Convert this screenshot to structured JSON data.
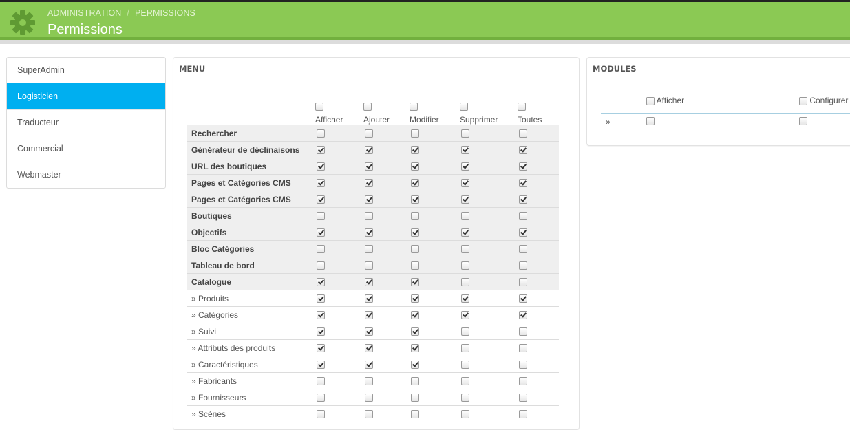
{
  "header": {
    "breadcrumb": [
      "ADMINISTRATION",
      "PERMISSIONS"
    ],
    "title": "Permissions",
    "colors": {
      "bar": "#8bc954",
      "accent_blue": "#00aff0"
    },
    "icon": "gear-icon"
  },
  "sidebar": {
    "items": [
      {
        "label": "SuperAdmin",
        "active": false
      },
      {
        "label": "Logisticien",
        "active": true
      },
      {
        "label": "Traducteur",
        "active": false
      },
      {
        "label": "Commercial",
        "active": false
      },
      {
        "label": "Webmaster",
        "active": false
      }
    ]
  },
  "menu": {
    "heading": "MENU",
    "columns": [
      "Afficher",
      "Ajouter",
      "Modifier",
      "Supprimer",
      "Toutes"
    ],
    "rows": [
      {
        "label": "Rechercher",
        "bold": true,
        "checks": [
          false,
          false,
          false,
          false,
          false
        ]
      },
      {
        "label": "Générateur de déclinaisons",
        "bold": true,
        "checks": [
          true,
          true,
          true,
          true,
          true
        ]
      },
      {
        "label": "URL des boutiques",
        "bold": true,
        "checks": [
          true,
          true,
          true,
          true,
          true
        ]
      },
      {
        "label": "Pages et Catégories CMS",
        "bold": true,
        "checks": [
          true,
          true,
          true,
          true,
          true
        ]
      },
      {
        "label": "Pages et Catégories CMS",
        "bold": true,
        "checks": [
          true,
          true,
          true,
          true,
          true
        ]
      },
      {
        "label": "Boutiques",
        "bold": true,
        "checks": [
          false,
          false,
          false,
          false,
          false
        ]
      },
      {
        "label": "Objectifs",
        "bold": true,
        "checks": [
          true,
          true,
          true,
          true,
          true
        ]
      },
      {
        "label": "Bloc Catégories",
        "bold": true,
        "checks": [
          false,
          false,
          false,
          false,
          false
        ]
      },
      {
        "label": "Tableau de bord",
        "bold": true,
        "checks": [
          false,
          false,
          false,
          false,
          false
        ]
      },
      {
        "label": "Catalogue",
        "bold": true,
        "checks": [
          true,
          true,
          true,
          false,
          false
        ]
      },
      {
        "label": "» Produits",
        "bold": false,
        "checks": [
          true,
          true,
          true,
          true,
          true
        ]
      },
      {
        "label": "» Catégories",
        "bold": false,
        "checks": [
          true,
          true,
          true,
          true,
          true
        ]
      },
      {
        "label": "» Suivi",
        "bold": false,
        "checks": [
          true,
          true,
          true,
          false,
          false
        ]
      },
      {
        "label": "» Attributs des produits",
        "bold": false,
        "checks": [
          true,
          true,
          true,
          false,
          false
        ]
      },
      {
        "label": "» Caractéristiques",
        "bold": false,
        "checks": [
          true,
          true,
          true,
          false,
          false
        ]
      },
      {
        "label": "» Fabricants",
        "bold": false,
        "checks": [
          false,
          false,
          false,
          false,
          false
        ]
      },
      {
        "label": "» Fournisseurs",
        "bold": false,
        "checks": [
          false,
          false,
          false,
          false,
          false
        ]
      },
      {
        "label": "» Scènes",
        "bold": false,
        "checks": [
          false,
          false,
          false,
          false,
          false
        ]
      }
    ]
  },
  "modules": {
    "heading": "MODULES",
    "columns": [
      "Afficher",
      "Configurer"
    ],
    "row_label": "»",
    "checks": [
      false,
      false
    ]
  }
}
